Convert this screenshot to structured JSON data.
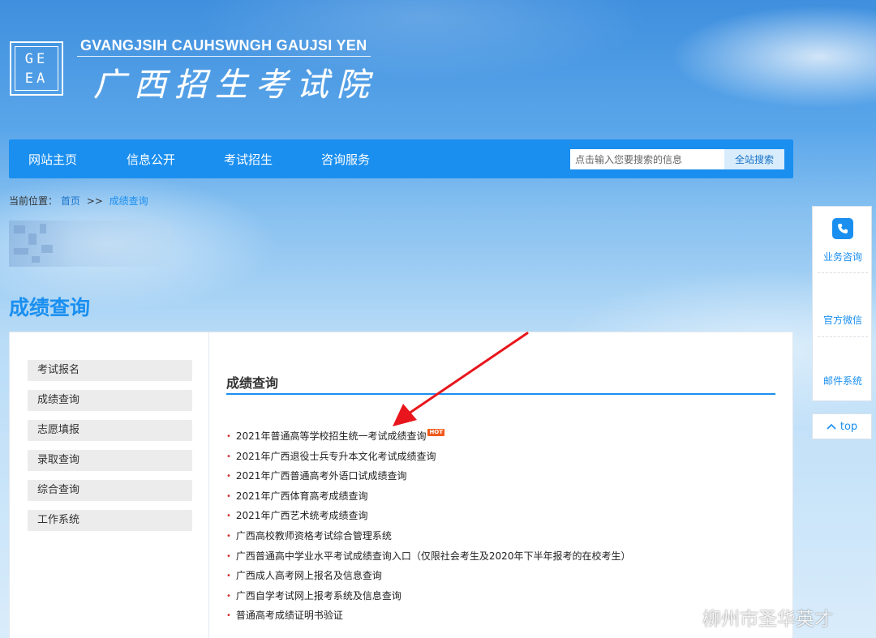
{
  "header": {
    "logo_text_top": "GE",
    "logo_text_bottom": "EA",
    "site_name_en": "GVANGJSIH CAUHSWNGH GAUJSI YEN",
    "site_name_cn": "广西招生考试院"
  },
  "nav": {
    "items": [
      {
        "label": "网站主页"
      },
      {
        "label": "信息公开"
      },
      {
        "label": "考试招生"
      },
      {
        "label": "咨询服务"
      }
    ],
    "search_placeholder": "点击输入您要搜索的信息",
    "search_button": "全站搜索"
  },
  "breadcrumb": {
    "prefix": "当前位置：",
    "home": "首页",
    "separator": ">>",
    "current": "成绩查询"
  },
  "page_title": "成绩查询",
  "sidebar": {
    "items": [
      {
        "label": "考试报名"
      },
      {
        "label": "成绩查询"
      },
      {
        "label": "志愿填报"
      },
      {
        "label": "录取查询"
      },
      {
        "label": "综合查询"
      },
      {
        "label": "工作系统"
      }
    ]
  },
  "main": {
    "section_title": "成绩查询",
    "hot_badge": "HOT",
    "links": [
      {
        "label": "2021年普通高等学校招生统一考试成绩查询"
      },
      {
        "label": "2021年广西退役士兵专升本文化考试成绩查询"
      },
      {
        "label": "2021年广西普通高考外语口试成绩查询"
      },
      {
        "label": "2021年广西体育高考成绩查询"
      },
      {
        "label": "2021年广西艺术统考成绩查询"
      },
      {
        "label": "广西高校教师资格考试综合管理系统"
      },
      {
        "label": "广西普通高中学业水平考试成绩查询入口（仅限社会考生及2020年下半年报考的在校考生）"
      },
      {
        "label": "广西成人高考网上报名及信息查询"
      },
      {
        "label": "广西自学考试网上报考系统及信息查询"
      },
      {
        "label": "普通高考成绩证明书验证"
      }
    ]
  },
  "float_panel": {
    "items": [
      {
        "label": "业务咨询",
        "icon": "phone-icon"
      },
      {
        "label": "官方微信"
      },
      {
        "label": "邮件系统"
      }
    ],
    "top_label": "top"
  },
  "watermark": {
    "text": "柳州市圣华英才"
  },
  "colors": {
    "primary": "#1a8ff0",
    "nav_bg": "#1a8ff0",
    "hot": "#f05a1c",
    "arrow": "#e8161c",
    "bullet": "#d0302e"
  }
}
